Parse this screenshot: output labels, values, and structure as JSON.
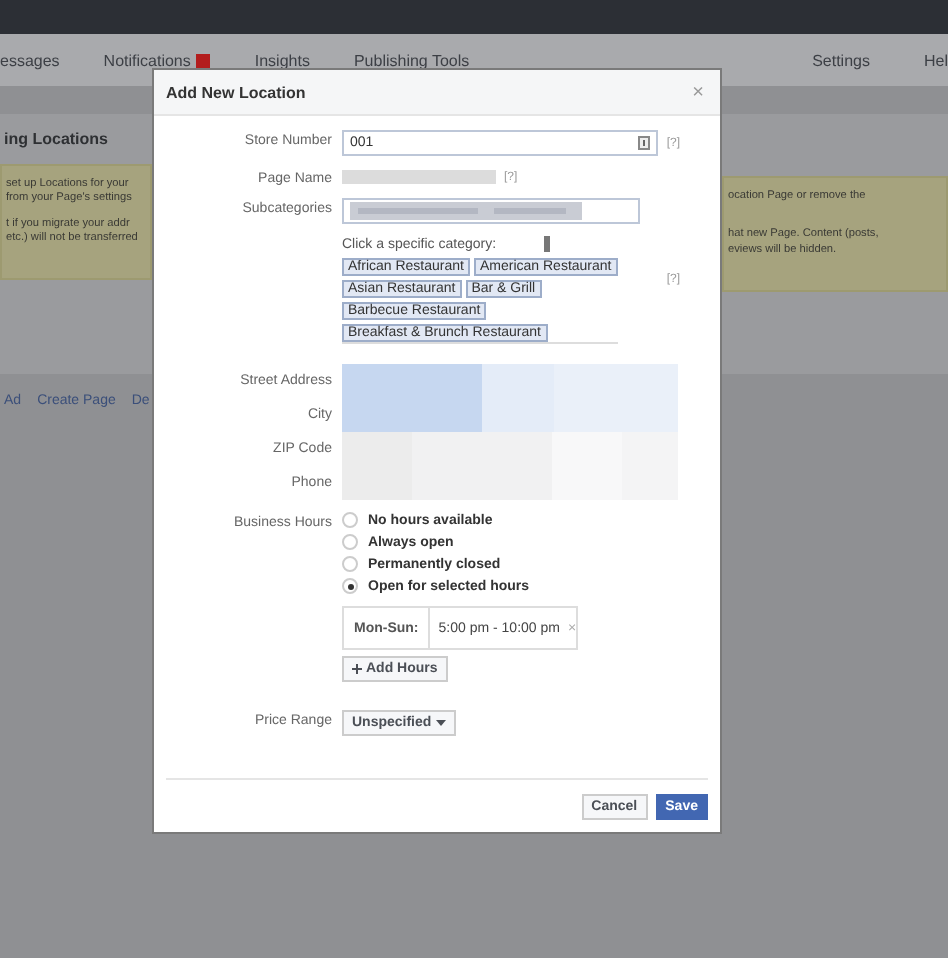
{
  "nav": {
    "items": [
      {
        "label": "essages",
        "badge": false
      },
      {
        "label": "Notifications",
        "badge": true
      },
      {
        "label": "Insights",
        "badge": false
      },
      {
        "label": "Publishing Tools",
        "badge": false
      }
    ],
    "right_items": [
      "Settings",
      "Hel"
    ]
  },
  "background": {
    "section_title": "ing Locations",
    "notice_left": [
      " set up Locations for your",
      "from your Page's settings",
      "t if you migrate your addr",
      "etc.) will not be transferred"
    ],
    "notice_right": [
      "ocation Page or remove the",
      "hat new Page. Content (posts,",
      "eviews will be hidden."
    ],
    "links": [
      "Ad",
      "Create Page",
      "De"
    ]
  },
  "dialog": {
    "title": "Add New Location",
    "close": "×",
    "store_number": {
      "label": "Store Number",
      "value": "001",
      "help": "[?]"
    },
    "page_name": {
      "label": "Page Name",
      "help": "[?]"
    },
    "subcategories": {
      "label": "Subcategories",
      "prompt": "Click a specific category:",
      "help": "[?]",
      "tags": [
        [
          "African Restaurant",
          "American Restaurant"
        ],
        [
          "Asian Restaurant",
          "Bar & Grill"
        ],
        [
          "Barbecue Restaurant"
        ],
        [
          "Breakfast & Brunch Restaurant"
        ]
      ]
    },
    "address_labels": [
      "Street Address",
      "City",
      "ZIP Code",
      "Phone"
    ],
    "business_hours": {
      "label": "Business Hours",
      "options": [
        {
          "label": "No hours available",
          "selected": false
        },
        {
          "label": "Always open",
          "selected": false
        },
        {
          "label": "Permanently closed",
          "selected": false
        },
        {
          "label": "Open for selected hours",
          "selected": true
        }
      ],
      "days": "Mon-Sun:",
      "range": "5:00 pm - 10:00 pm",
      "remove": "×",
      "add": "Add Hours"
    },
    "price_range": {
      "label": "Price Range",
      "value": "Unspecified"
    },
    "buttons": {
      "cancel": "Cancel",
      "save": "Save"
    }
  }
}
